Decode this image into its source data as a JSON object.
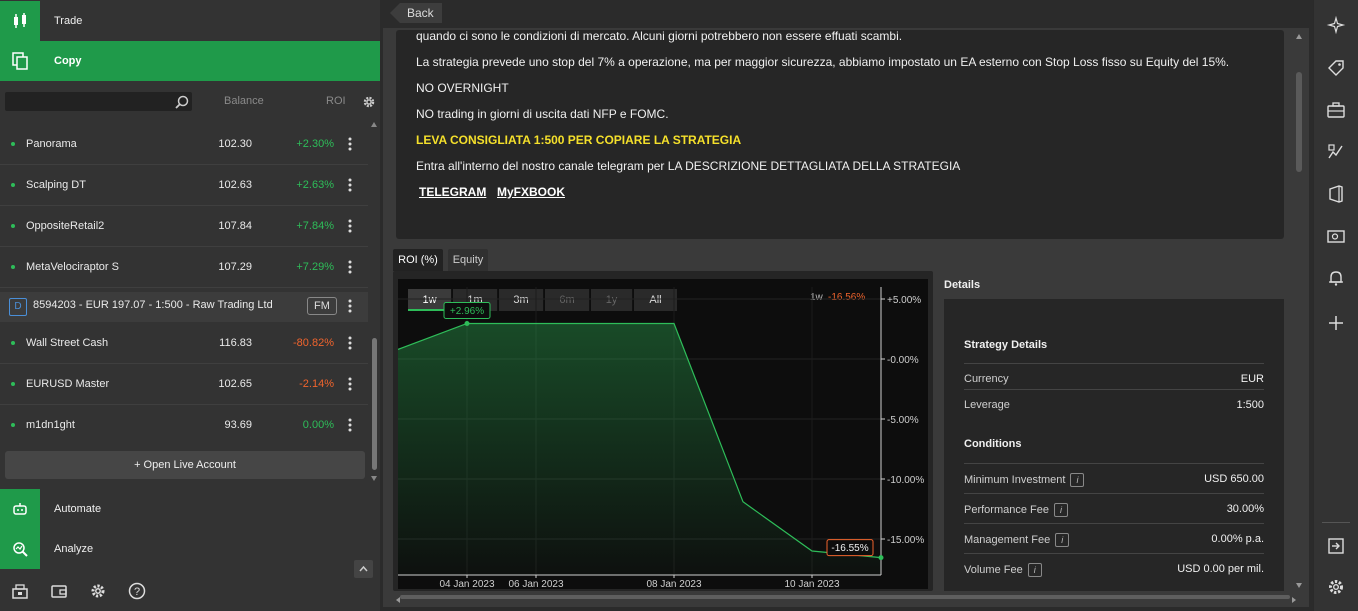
{
  "nav": {
    "trade": "Trade",
    "copy": "Copy",
    "automate": "Automate",
    "analyze": "Analyze"
  },
  "list": {
    "search_placeholder": "",
    "col_balance": "Balance",
    "col_roi": "ROI",
    "rows": [
      {
        "name": "Panorama",
        "balance": "102.30",
        "roi": "+2.30%"
      },
      {
        "name": "Scalping DT",
        "balance": "102.63",
        "roi": "+2.63%"
      },
      {
        "name": "OppositeRetail2",
        "balance": "107.84",
        "roi": "+7.84%"
      },
      {
        "name": "MetaVelociraptor S",
        "balance": "107.29",
        "roi": "+7.29%"
      }
    ],
    "account": {
      "badge": "D",
      "label": "8594203 - EUR 197.07 - 1:500 - Raw Trading Ltd",
      "tag": "FM"
    },
    "rows2": [
      {
        "name": "Wall Street Cash",
        "balance": "116.83",
        "roi": "-80.82%"
      },
      {
        "name": "EURUSD Master",
        "balance": "102.65",
        "roi": "-2.14%"
      },
      {
        "name": "m1dn1ght",
        "balance": "93.69",
        "roi": "0.00%"
      }
    ],
    "open_live": "+ Open Live Account"
  },
  "main": {
    "back": "Back",
    "desc": [
      "quando ci sono le condizioni di mercato. Alcuni giorni potrebbero non essere effuati scambi.",
      "La strategia prevede uno stop del 7% a operazione, ma per maggior sicurezza, abbiamo impostato un EA esterno con Stop Loss fisso su Equity del  15%.",
      "NO OVERNIGHT",
      "NO trading in giorni di uscita dati NFP e FOMC.",
      "LEVA CONSIGLIATA  1:500 PER COPIARE LA STRATEGIA",
      "Entra all'interno del nostro canale telegram per LA DESCRIZIONE DETTAGLIATA DELLA STRATEGIA"
    ],
    "links": {
      "telegram": "TELEGRAM",
      "myfxbook": "MyFXBOOK"
    },
    "tabs": {
      "roi": "ROI (%)",
      "equity": "Equity"
    }
  },
  "chart_controls": {
    "periods": [
      "1w",
      "1m",
      "3m",
      "6m",
      "1y",
      "All"
    ],
    "selected": "1w",
    "disabled": [
      "6m",
      "1y"
    ],
    "summary_period": "1w",
    "summary_value": "-16.56%"
  },
  "chart_data": {
    "type": "area",
    "x": [
      "03 Jan 2023",
      "04 Jan 2023",
      "06 Jan 2023",
      "07 Jan 2023",
      "08 Jan 2023",
      "09 Jan 2023",
      "10 Jan 2023",
      "11 Jan 2023"
    ],
    "values": [
      0.8,
      2.96,
      2.96,
      2.96,
      2.96,
      -11.9,
      -16.0,
      -16.55
    ],
    "x_tick_labels": [
      "04 Jan 2023",
      "06 Jan 2023",
      "08 Jan 2023",
      "10 Jan 2023"
    ],
    "y_tick_labels": [
      "+5.00%",
      "-0.00%",
      "-5.00%",
      "-10.00%",
      "-15.00%"
    ],
    "y_ticks": [
      5,
      0,
      -5,
      -10,
      -15
    ],
    "ylim": [
      -18,
      6
    ],
    "annotations": [
      {
        "label": "+2.96%",
        "x": "04 Jan 2023",
        "y": 2.96,
        "color": "#2ebd59"
      },
      {
        "label": "-16.55%",
        "x": "11 Jan 2023",
        "y": -16.55,
        "color": "#f0642d"
      }
    ],
    "series_color": "#2ebd59"
  },
  "details": {
    "title": "Details",
    "strategy_heading": "Strategy Details",
    "strategy": [
      {
        "key": "Currency",
        "value": "EUR"
      },
      {
        "key": "Leverage",
        "value": "1:500"
      }
    ],
    "conditions_heading": "Conditions",
    "conditions": [
      {
        "key": "Minimum Investment",
        "value": "USD 650.00"
      },
      {
        "key": "Performance Fee",
        "value": "30.00%"
      },
      {
        "key": "Management Fee",
        "value": "0.00% p.a."
      },
      {
        "key": "Volume Fee",
        "value": "USD 0.00 per mil."
      }
    ]
  },
  "colors": {
    "accent": "#1f9a4a",
    "positive": "#2ebd59",
    "negative": "#f0642d",
    "highlight": "#f5e02b"
  }
}
